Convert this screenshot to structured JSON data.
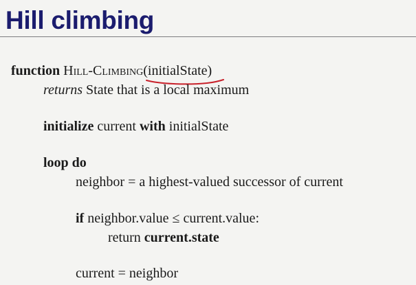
{
  "slide": {
    "title": "Hill climbing"
  },
  "code": {
    "signature": {
      "keyword": "function",
      "name": "Hill-Climbing",
      "open_paren": "(",
      "param": "initialState",
      "close_paren": ")"
    },
    "returns": {
      "keyword": "returns",
      "text": "State that is a local maximum"
    },
    "init": {
      "kw1": "initialize",
      "mid": "current",
      "kw2": "with",
      "tail": "initialState"
    },
    "loop": {
      "keyword": "loop do"
    },
    "neighbor_line": "neighbor = a highest-valued successor of current",
    "if_line": {
      "keyword": "if",
      "condition": "neighbor.value ≤ current.value:"
    },
    "return_line": {
      "keyword": "return",
      "value": "current.state"
    },
    "assign_line": "current = neighbor"
  },
  "colors": {
    "title": "#1b1c6e",
    "annotation": "#c8202a",
    "rule": "#7d7d80"
  }
}
